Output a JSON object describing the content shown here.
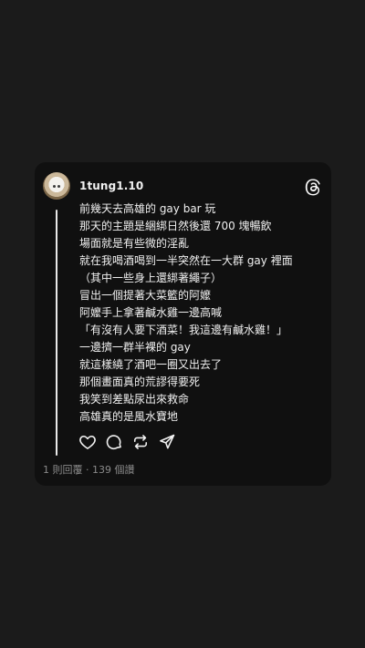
{
  "post": {
    "username": "1tung1.10",
    "avatar_icon": "cat-avatar",
    "app_icon": "threads-logo-icon",
    "lines": [
      "前幾天去高雄的 gay bar 玩",
      "那天的主題是綑綁日然後還 700 塊暢飲",
      "場面就是有些微的淫亂",
      "就在我喝酒喝到一半突然在一大群 gay 裡面",
      "（其中一些身上還綁著繩子）",
      "冒出一個提著大菜籃的阿嬤",
      "阿嬤手上拿著鹹水雞一邊高喊",
      "「有沒有人要下酒菜！我這邊有鹹水雞！」",
      "一邊擠一群半裸的 gay",
      "就這樣繞了酒吧一圈又出去了",
      "那個畫面真的荒謬得要死",
      "我笑到差點尿出來救命",
      "高雄真的是風水寶地"
    ],
    "actions": [
      "heart-icon",
      "comment-icon",
      "repost-icon",
      "share-icon"
    ],
    "stats_text": "1 則回覆 · 139 個讚"
  },
  "colors": {
    "background": "#1b1b1b",
    "card": "#101010",
    "text": "#f0f0f0",
    "muted": "#8a8a8a"
  }
}
